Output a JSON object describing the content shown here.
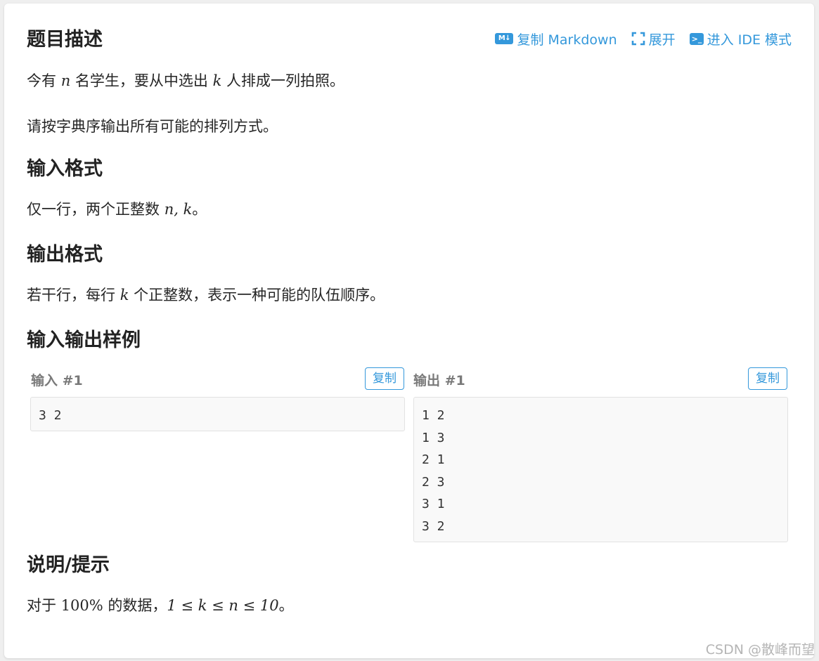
{
  "problem": {
    "title": "题目描述",
    "actions": [
      {
        "label": "复制 Markdown",
        "icon": "markdown-icon"
      },
      {
        "label": "展开",
        "icon": "expand-icon"
      },
      {
        "label": "进入 IDE 模式",
        "icon": "terminal-icon"
      }
    ],
    "md_icon_text": "M↓",
    "desc_line1_pre": "今有 ",
    "desc_var_n": "n",
    "desc_line1_mid": " 名学生，要从中选出 ",
    "desc_var_k": "k",
    "desc_line1_post": " 人排成一列拍照。",
    "desc_line2": "请按字典序输出所有可能的排列方式。"
  },
  "input_format": {
    "title": "输入格式",
    "text_pre": "仅一行，两个正整数 ",
    "math": "n, k",
    "text_post": "。"
  },
  "output_format": {
    "title": "输出格式",
    "text_pre": "若干行，每行 ",
    "math": "k",
    "text_post": " 个正整数，表示一种可能的队伍顺序。"
  },
  "samples": {
    "title": "输入输出样例",
    "input_label": "输入 #1",
    "output_label": "输出 #1",
    "copy_label": "复制",
    "input_lines": [
      "3 2"
    ],
    "output_lines": [
      "1 2",
      "1 3",
      "2 1",
      "2 3",
      "3 1",
      "3 2"
    ]
  },
  "hint": {
    "title": "说明/提示",
    "text_pre": "对于 ",
    "percent": "100%",
    "text_mid": " 的数据，",
    "constraint": "1 ≤ k ≤ n ≤ 10",
    "text_post": "。"
  },
  "watermark": "CSDN @散峰而望",
  "colors": {
    "accent": "#3498db",
    "code_bg": "#f9f9f9",
    "label_gray": "#7a7a7a"
  }
}
